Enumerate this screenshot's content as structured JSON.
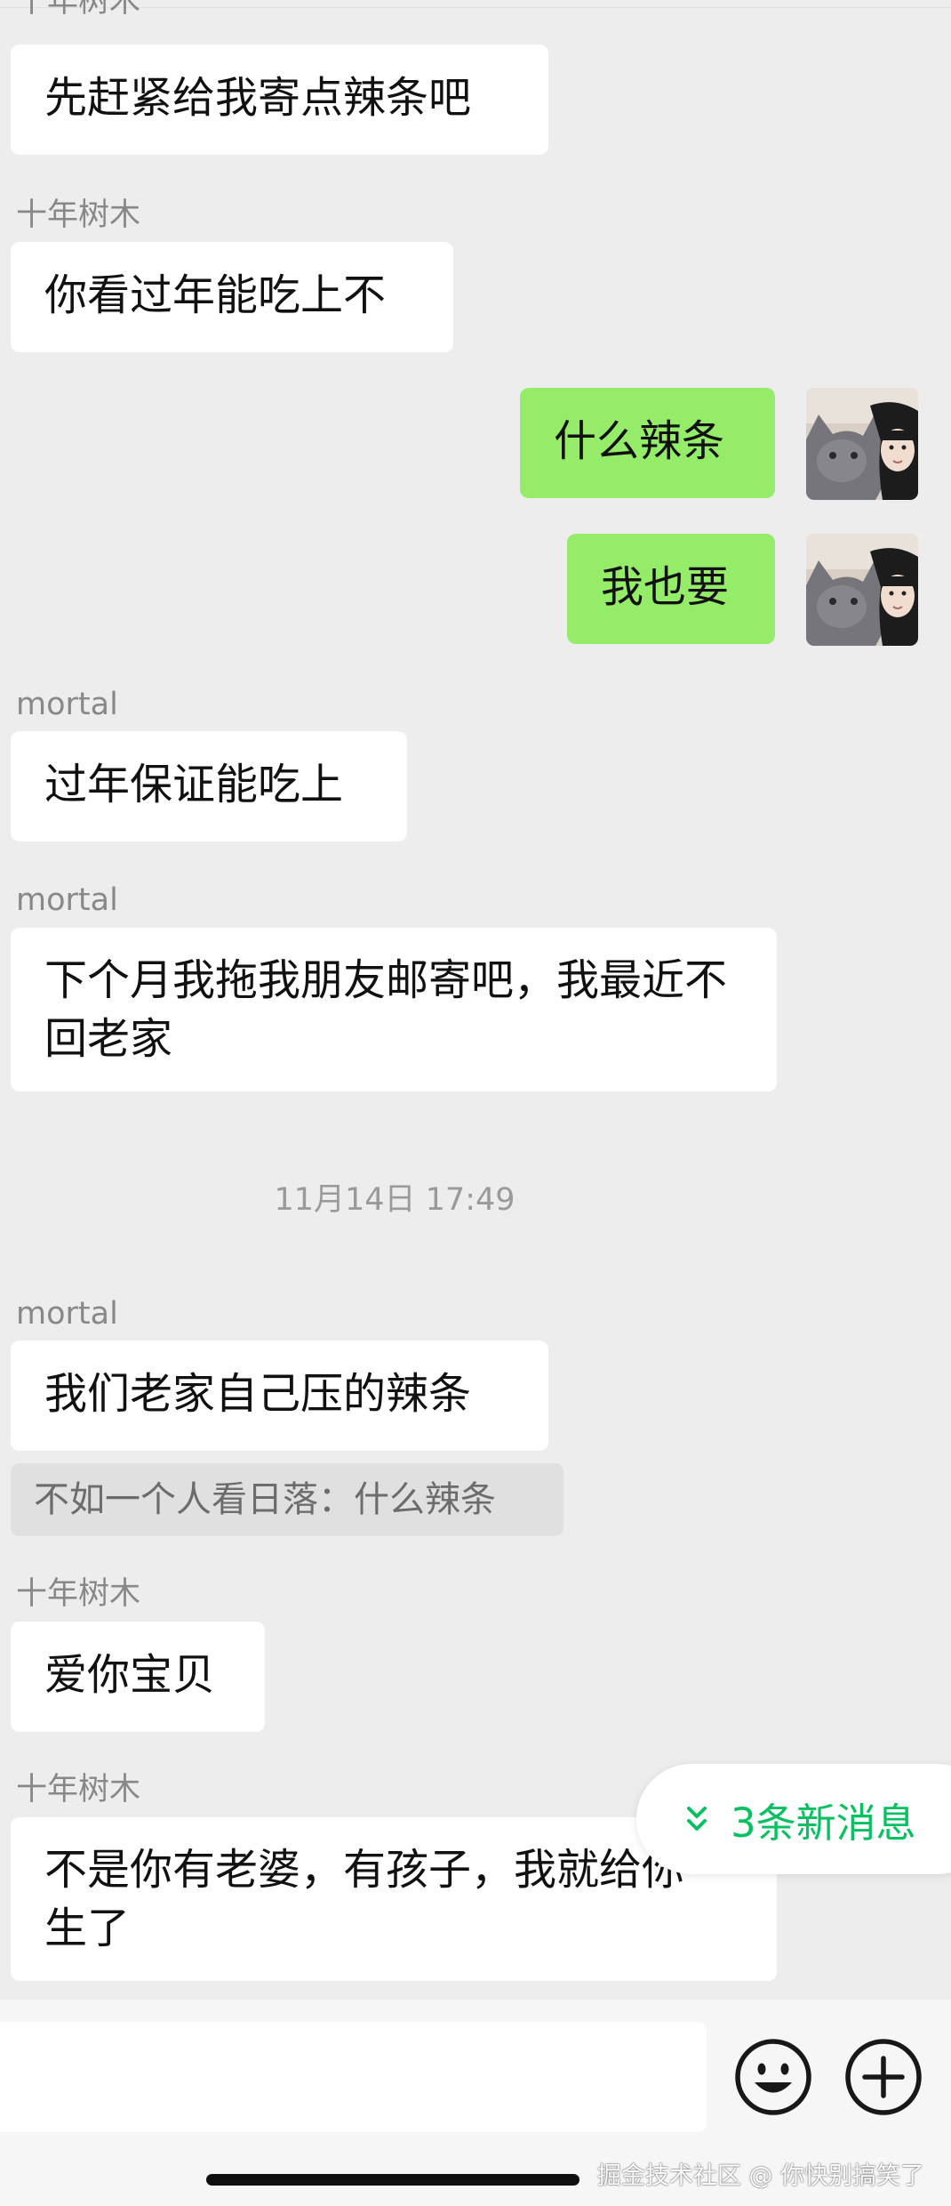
{
  "messages": [
    {
      "sender": "十年树木",
      "text": "先赶紧给我寄点辣条吧"
    },
    {
      "sender": "十年树木",
      "text": "你看过年能吃上不"
    },
    {
      "sender": "",
      "text": "什么辣条",
      "outgoing": true
    },
    {
      "sender": "",
      "text": "我也要",
      "outgoing": true
    },
    {
      "sender": "mortal",
      "text": "过年保证能吃上"
    },
    {
      "sender": "mortal",
      "text": "下个月我拖我朋友邮寄吧，我最近不回老家"
    },
    {
      "sender": "mortal",
      "text": "我们老家自己压的辣条",
      "quote": "不如一个人看日落：什么辣条"
    },
    {
      "sender": "十年树木",
      "text": "爱你宝贝"
    },
    {
      "sender": "十年树木",
      "text": "不是你有老婆，有孩子，我就给你生了"
    }
  ],
  "timestamp": "11月14日 17:49",
  "new_messages_label": "3条新消息",
  "watermark": "掘金技术社区 @ 你快别搞笑了",
  "colors": {
    "background": "#ededed",
    "incoming_bubble": "#ffffff",
    "outgoing_bubble": "#95ec69",
    "accent_green": "#07c160",
    "sender_name": "#888888",
    "quote_background": "#e0e0e0"
  },
  "icons": {
    "new_messages": "double-chevron-down-icon",
    "emoji": "smiley-face-icon",
    "more": "plus-circle-icon",
    "avatar": "cat-and-girl-avatar"
  }
}
